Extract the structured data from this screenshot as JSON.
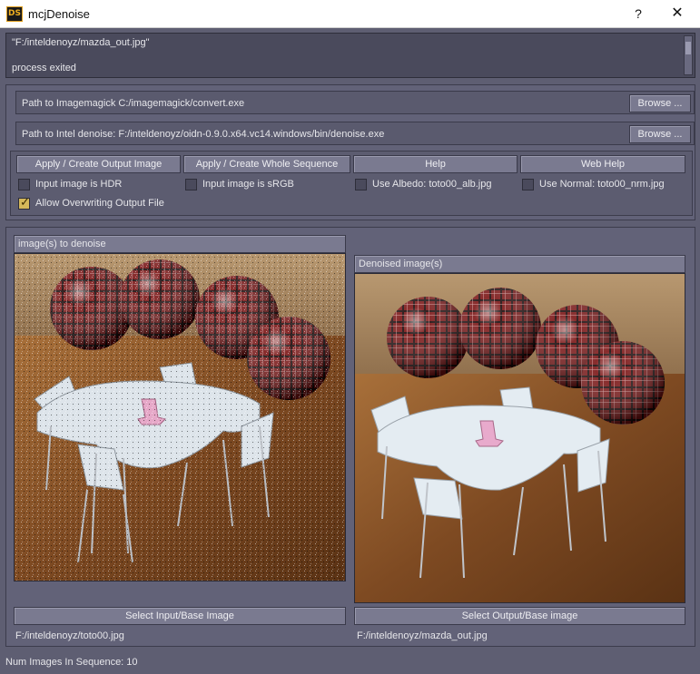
{
  "window": {
    "title": "mcjDenoise",
    "icon": "DS",
    "help": "?",
    "close": "✕"
  },
  "log": {
    "lines": [
      "\"F:/inteldenoyz/mazda_out.jpg\"",
      "",
      "process exited"
    ]
  },
  "paths": {
    "imagemagick_label": "Path to Imagemagick  C:/imagemagick/convert.exe",
    "denoise_label": "Path to Intel denoise: F:/inteldenoyz/oidn-0.9.0.x64.vc14.windows/bin/denoise.exe",
    "browse_label": "Browse ..."
  },
  "actions": {
    "apply_output": "Apply / Create Output Image",
    "apply_sequence": "Apply / Create Whole Sequence",
    "help": "Help",
    "web_help": "Web Help"
  },
  "options": {
    "hdr": "Input image is HDR",
    "srgb": "Input image is sRGB",
    "albedo": "Use Albedo: toto00_alb.jpg",
    "normal": "Use Normal: toto00_nrm.jpg",
    "overwrite": "Allow Overwriting Output File"
  },
  "input_panel": {
    "header": "image(s) to denoise",
    "select_label": "Select Input/Base Image",
    "path": "F:/inteldenoyz/toto00.jpg"
  },
  "output_panel": {
    "header": "Denoised image(s)",
    "select_label": "Select Output/Base image",
    "path": "F:/inteldenoyz/mazda_out.jpg"
  },
  "status": "Num Images In Sequence: 10",
  "colors": {
    "background": "#5e5e72",
    "button": "#7a7a90",
    "checkbox_checked": "#d4b85a",
    "floor": "#8a5428",
    "sphere": "#8a1a1a"
  }
}
